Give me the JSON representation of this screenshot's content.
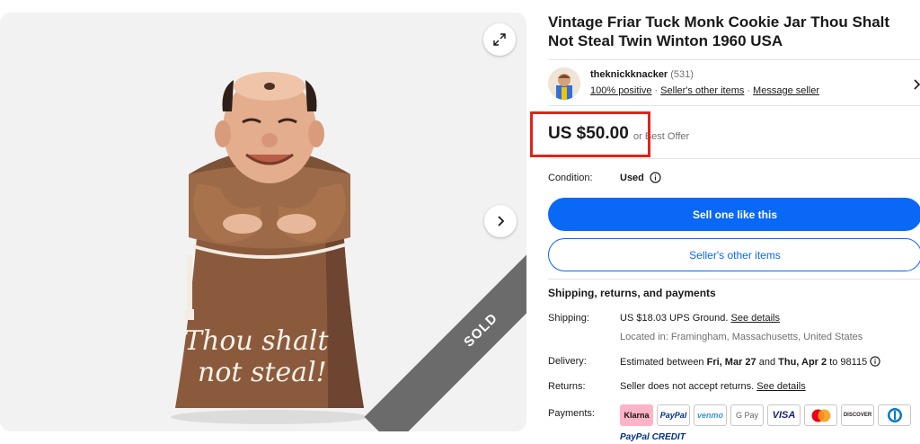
{
  "gallery": {
    "image_alt": "Friar Tuck monk cookie jar",
    "jar_text_line1": "Thou shalt",
    "jar_text_line2": "not steal!",
    "sold_label": "SOLD",
    "expand_icon": "expand-icon",
    "next_icon": "chevron-right-icon"
  },
  "listing": {
    "title": "Vintage Friar Tuck Monk Cookie Jar Thou Shalt Not Steal Twin Winton 1960 USA"
  },
  "seller": {
    "name": "theknickknacker",
    "feedback": "(531)",
    "positive": "100% positive",
    "other_items": "Seller's other items",
    "message": "Message seller"
  },
  "price": {
    "amount": "US $50.00",
    "offer": "or Best Offer",
    "highlight_color": "#e2231a"
  },
  "condition": {
    "label": "Condition:",
    "value": "Used"
  },
  "buttons": {
    "sell_one": "Sell one like this",
    "other_items": "Seller's other items",
    "primary_color": "#0968f6"
  },
  "shipping": {
    "heading": "Shipping, returns, and payments",
    "shipping_label": "Shipping:",
    "shipping_value": "US $18.03 UPS Ground.",
    "shipping_link": "See details",
    "location": "Located in: Framingham, Massachusetts, United States",
    "delivery_label": "Delivery:",
    "delivery_prefix": "Estimated between",
    "delivery_start": "Fri, Mar 27",
    "delivery_and": "and",
    "delivery_end": "Thu, Apr 2",
    "delivery_suffix": "to 98115",
    "returns_label": "Returns:",
    "returns_value": "Seller does not accept returns.",
    "returns_link": "See details",
    "payments_label": "Payments:"
  },
  "payments": {
    "methods": [
      "Klarna",
      "PayPal",
      "venmo",
      "G Pay",
      "VISA",
      "Mastercard",
      "DISCOVER",
      "Diners Club"
    ],
    "paypal_credit": "PayPal CREDIT"
  }
}
